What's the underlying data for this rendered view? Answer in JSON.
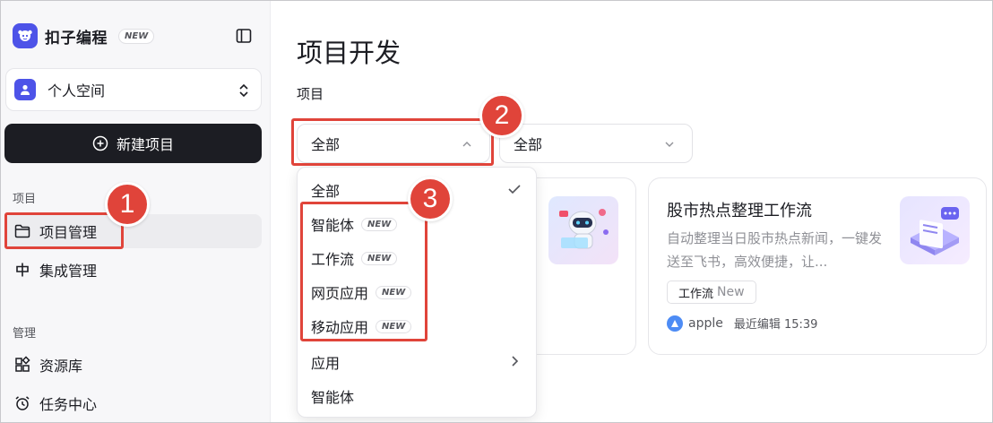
{
  "colors": {
    "accent": "#4d53e8",
    "annotation": "#e0443a",
    "primary_button": "#1c1d23",
    "muted_text": "#8f9096"
  },
  "brand": {
    "name": "扣子编程",
    "badge": "NEW"
  },
  "sidebar": {
    "space_label": "个人空间",
    "new_project_label": "新建项目",
    "project_section": "项目",
    "project_items": [
      {
        "label": "项目管理",
        "icon": "folder-icon",
        "active": true
      },
      {
        "label": "集成管理",
        "icon": "integration-icon",
        "active": false
      }
    ],
    "manage_section": "管理",
    "manage_items": [
      {
        "label": "资源库",
        "icon": "library-icon"
      },
      {
        "label": "任务中心",
        "icon": "alarm-clock-icon"
      }
    ]
  },
  "main": {
    "title": "项目开发",
    "filter_label": "项目",
    "type_filter_value": "全部",
    "status_filter_value": "全部"
  },
  "dropdown": {
    "items": [
      {
        "label": "全部",
        "badge": "",
        "selected": true
      },
      {
        "label": "智能体",
        "badge": "NEW"
      },
      {
        "label": "工作流",
        "badge": "NEW"
      },
      {
        "label": "网页应用",
        "badge": "NEW"
      },
      {
        "label": "移动应用",
        "badge": "NEW"
      },
      {
        "label": "应用",
        "badge": "",
        "has_submenu": true
      },
      {
        "label": "智能体",
        "badge": ""
      }
    ]
  },
  "cards": [
    {
      "title": "股市热点整理工作流",
      "description": "自动整理当日股市热点新闻，一键发送至飞书，高效便捷，让...",
      "tag": "工作流",
      "tag_suffix": "New",
      "owner": "apple",
      "edited": "最近编辑 15:39"
    }
  ],
  "annotations": {
    "marker_1": "1",
    "marker_2": "2",
    "marker_3": "3"
  }
}
